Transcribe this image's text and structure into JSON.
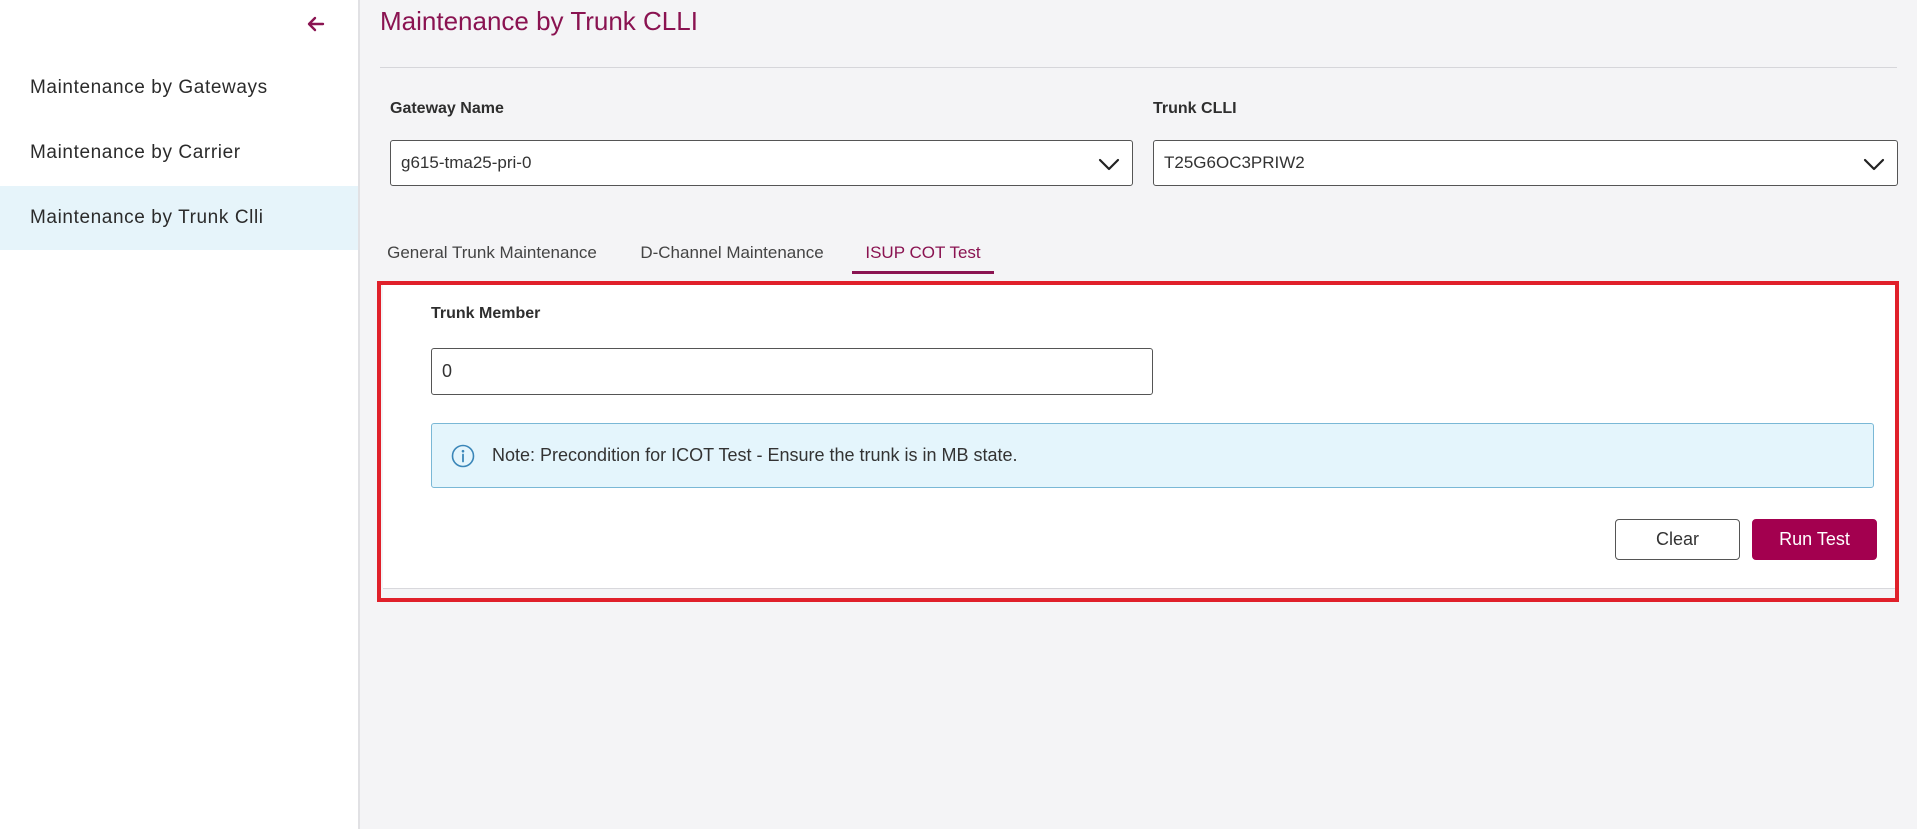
{
  "colors": {
    "accent": "#8a1351",
    "button_primary": "#a3004f",
    "active_nav_bg": "#e6f4fa",
    "note_bg": "#e4f5fc",
    "highlight_border": "#e0202a"
  },
  "sidebar": {
    "back_icon": "arrow-left-icon",
    "items": [
      {
        "label": "Maintenance by Gateways",
        "active": false
      },
      {
        "label": "Maintenance by Carrier",
        "active": false
      },
      {
        "label": "Maintenance by Trunk Clli",
        "active": true
      }
    ]
  },
  "header": {
    "title": "Maintenance by Trunk CLLI"
  },
  "filters": {
    "gateway": {
      "label": "Gateway Name",
      "value": "g615-tma25-pri-0",
      "icon": "chevron-down-icon"
    },
    "trunk_clli": {
      "label": "Trunk CLLI",
      "value": "T25G6OC3PRIW2",
      "icon": "chevron-down-icon"
    }
  },
  "tabs": [
    {
      "label": "General Trunk Maintenance",
      "active": false
    },
    {
      "label": "D-Channel Maintenance",
      "active": false
    },
    {
      "label": "ISUP COT Test",
      "active": true
    }
  ],
  "panel": {
    "trunk_member": {
      "label": "Trunk Member",
      "value": "0"
    },
    "note": {
      "icon": "info-icon",
      "text": "Note: Precondition for ICOT Test - Ensure the trunk is in MB state."
    },
    "buttons": {
      "clear": "Clear",
      "run": "Run Test"
    }
  }
}
